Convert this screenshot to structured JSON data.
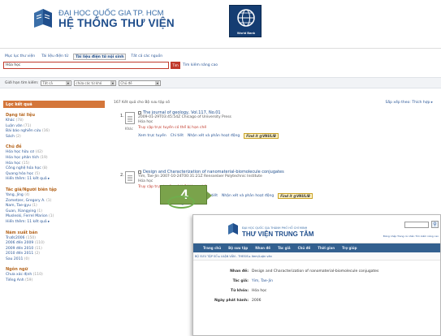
{
  "header": {
    "subtitle": "ĐẠI HỌC QUỐC GIA TP. HCM",
    "title": "HỆ THỐNG THƯ VIỆN",
    "partner_logo_text": "World Bank"
  },
  "search": {
    "tabs": [
      "Mục lục thư viện",
      "Tài liệu điện tử",
      "Tài liệu điện tử nội sinh",
      "Tất cả các nguồn"
    ],
    "active_tab": 2,
    "query": "Hóa học",
    "button_label": "Tìm",
    "advanced_link": "Tìm kiếm nâng cao"
  },
  "filters": {
    "label": "Giới hạn tìm kiếm:",
    "select1": "Tất cả",
    "select2": "chứa các từ khó",
    "select3": "Chủ đề"
  },
  "sidebar": {
    "heading": "Lọc kết quả",
    "facets": [
      {
        "title": "Dạng tài liệu",
        "items": [
          {
            "label": "Khác",
            "count": "(78)"
          },
          {
            "label": "Luận văn",
            "count": "(71)"
          },
          {
            "label": "Bài báo nghiên cứu",
            "count": "(16)"
          },
          {
            "label": "Sách",
            "count": "(2)"
          }
        ]
      },
      {
        "title": "Chủ đề",
        "items": [
          {
            "label": "Hóa học hữu cơ",
            "count": "(42)"
          },
          {
            "label": "Hóa học phân tích",
            "count": "(19)"
          },
          {
            "label": "Hóa học",
            "count": "(15)"
          },
          {
            "label": "Công nghệ hóa học",
            "count": "(8)"
          },
          {
            "label": "Quang hóa học",
            "count": "(5)"
          },
          {
            "label": "Hiển thêm: 11 kết quả ▸",
            "count": ""
          }
        ]
      },
      {
        "title": "Tác giả/Người biên tập",
        "items": [
          {
            "label": "Yang, Jing",
            "count": "(4)"
          },
          {
            "label": "Zometzer, Gregory A.",
            "count": "(1)"
          },
          {
            "label": "Nam, Tae-gyu",
            "count": "(1)"
          },
          {
            "label": "Guan, Xiangying",
            "count": "(1)"
          },
          {
            "label": "Musleski, Ferrel Marion",
            "count": "(1)"
          },
          {
            "label": "Hiển thêm: 11 kết quả ▸",
            "count": ""
          }
        ]
      },
      {
        "title": "Năm xuất bản",
        "items": [
          {
            "label": "Trước2006",
            "count": "(150)"
          },
          {
            "label": "2006 đến 2009",
            "count": "(110)"
          },
          {
            "label": "2009 đến 2010",
            "count": "(11)"
          },
          {
            "label": "2010 đến 2011",
            "count": "(2)"
          },
          {
            "label": "Sau 2011",
            "count": "(0)"
          }
        ]
      },
      {
        "title": "Ngôn ngữ",
        "items": [
          {
            "label": "Chưa xác định",
            "count": "(110)"
          },
          {
            "label": "Tiếng Anh",
            "count": "(59)"
          }
        ]
      }
    ]
  },
  "results": {
    "summary": "167 Kết quả cho Bộ sưu tập số",
    "sort": "Sắp xếp theo: Thích hợp ▸",
    "items": [
      {
        "number": "1.",
        "type": "Khác",
        "title": "The journal of geology, Vol.117, No.01",
        "meta": "2009-01-29T03:45:54Z  Chicago of University Press",
        "subject": "Hóa học",
        "access": "Truy cập trực tuyến có thể bị hạn chế",
        "actions": [
          "Xem trực tuyến",
          "Chi tiết",
          "Nhận xét và phản hoạt động"
        ],
        "findit": "Find it @VNULIB"
      },
      {
        "number": "2.",
        "type": "",
        "title": "Design and Characterization of nanomaterial-biomolecule conjugates",
        "meta": "Yim, Tae-Jin  2007-10-24T00:31:21Z  Rensselaer Polytechnic Institute",
        "subject": "Hóa học",
        "access": "Truy cập trực tuyến có thể bị hạn chế",
        "actions": [
          "Xem trực tuyến",
          "Chi tiết",
          "Nhận xét và phản hoạt động"
        ],
        "findit": "Find it @VNULIB",
        "extra": "Mở trong cửa sổ mới"
      }
    ]
  },
  "callout": {
    "step": "4"
  },
  "popup": {
    "subtitle": "ĐẠI HỌC QUỐC GIA THÀNH PHỐ HỒ CHÍ MINH",
    "title": "THƯ VIỆN TRUNG TÂM",
    "toplinks": "Đăng nhập  Trang cá nhân  Tìm kiếm nâng cao",
    "nav": [
      "Trang chủ",
      "Bộ sưu tập",
      "Nhan đề",
      "Tác giả",
      "Chủ đề",
      "Thời gian",
      "Trợ giúp"
    ],
    "breadcrumb": "BỘ SƯU TẬP SỐ ▸ LUẬN VĂN - THESIS ▸ Item/Luận văn",
    "fields": [
      {
        "key": "Nhan đề:",
        "value": "Design and Characterization of nanomaterial-biomolecule conjugates",
        "link": false
      },
      {
        "key": "Tác giả:",
        "value": "Yim, Tae-Jin",
        "link": true
      },
      {
        "key": "Từ khóa:",
        "value": "Hóa học",
        "link": false
      },
      {
        "key": "Ngày phát hành:",
        "value": "2006",
        "link": false
      }
    ]
  },
  "colors": {
    "brand_blue": "#1f4e8c",
    "accent_orange": "#d4763a",
    "step_green": "#7aa34b",
    "search_red": "#c0392b"
  }
}
